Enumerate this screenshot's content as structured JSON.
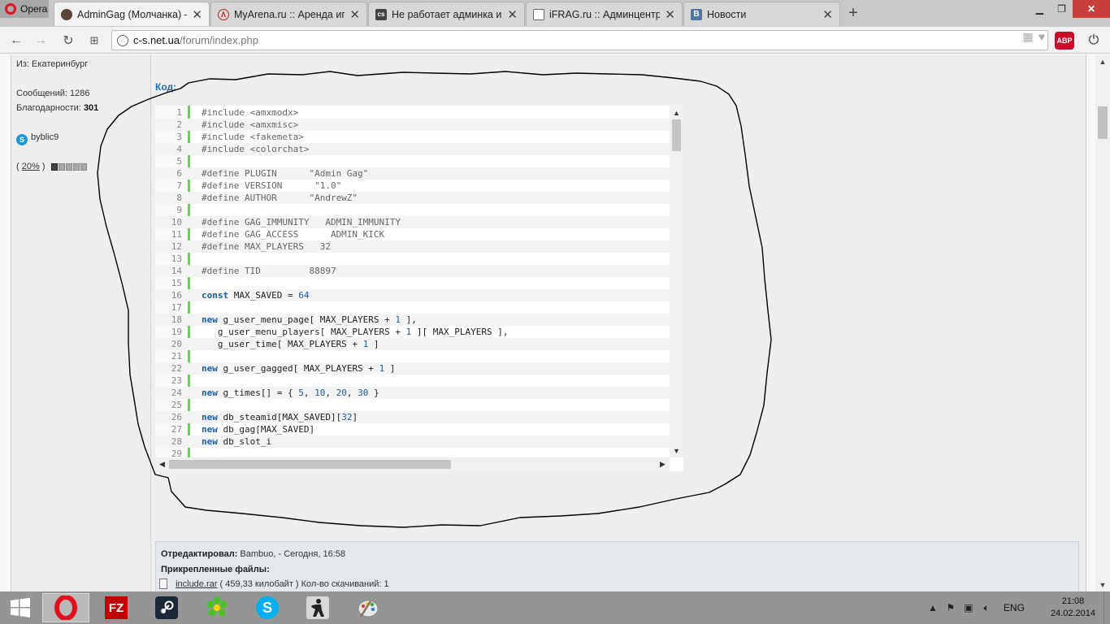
{
  "browser": {
    "menu_label": "Opera",
    "tabs": [
      {
        "title": "AdminGag (Молчанка) —",
        "active": true,
        "favicon": "user-silhouette-icon"
      },
      {
        "title": "MyArena.ru :: Аренда игро",
        "active": false,
        "favicon": "myarena-icon"
      },
      {
        "title": "Не работает админка и п",
        "active": false,
        "favicon": "forum-icon"
      },
      {
        "title": "iFRAG.ru :: Админцентр -",
        "active": false,
        "favicon": "page-icon"
      },
      {
        "title": "Новости",
        "active": false,
        "favicon": "vk-icon"
      }
    ],
    "new_tab": "+",
    "url_host": "c-s.net.ua",
    "url_path": "/forum/index.php",
    "abp_label": "ABP"
  },
  "profile": {
    "location": "Из: Екатеринбург",
    "messages_label": "Сообщений:",
    "messages_value": "1286",
    "thanks_label": "Благодарности:",
    "thanks_value": "301",
    "skype_name": "byblic9",
    "rep_open": "(",
    "rep_percent": "20%",
    "rep_close": ")",
    "rep_level": 0.2
  },
  "post": {
    "code_label": "Код:",
    "code_lines": [
      {
        "n": "1",
        "parts": [
          [
            "p",
            "#include <amxmodx>"
          ]
        ]
      },
      {
        "n": "2",
        "parts": [
          [
            "p",
            "#include <amxmisc>"
          ]
        ]
      },
      {
        "n": "3",
        "parts": [
          [
            "p",
            "#include <fakemeta>"
          ]
        ]
      },
      {
        "n": "4",
        "parts": [
          [
            "p",
            "#include <colorchat>"
          ]
        ]
      },
      {
        "n": "5",
        "parts": []
      },
      {
        "n": "6",
        "parts": [
          [
            "p",
            "#define PLUGIN      \"Admin Gag\""
          ]
        ]
      },
      {
        "n": "7",
        "parts": [
          [
            "p",
            "#define VERSION      \"1.0\""
          ]
        ]
      },
      {
        "n": "8",
        "parts": [
          [
            "p",
            "#define AUTHOR      \"AndrewZ\""
          ]
        ]
      },
      {
        "n": "9",
        "parts": []
      },
      {
        "n": "10",
        "parts": [
          [
            "p",
            "#define GAG_IMMUNITY   ADMIN_IMMUNITY"
          ]
        ]
      },
      {
        "n": "11",
        "parts": [
          [
            "p",
            "#define GAG_ACCESS      ADMIN_KICK"
          ]
        ]
      },
      {
        "n": "12",
        "parts": [
          [
            "p",
            "#define MAX_PLAYERS   32"
          ]
        ]
      },
      {
        "n": "13",
        "parts": []
      },
      {
        "n": "14",
        "parts": [
          [
            "p",
            "#define TID         88897"
          ]
        ]
      },
      {
        "n": "15",
        "parts": []
      },
      {
        "n": "16",
        "parts": [
          [
            "k",
            "const"
          ],
          [
            "t",
            " MAX_SAVED = "
          ],
          [
            "d",
            "64"
          ]
        ]
      },
      {
        "n": "17",
        "parts": []
      },
      {
        "n": "18",
        "parts": [
          [
            "k",
            "new"
          ],
          [
            "t",
            " g_user_menu_page[ MAX_PLAYERS + "
          ],
          [
            "d",
            "1"
          ],
          [
            "t",
            " ],"
          ]
        ]
      },
      {
        "n": "19",
        "parts": [
          [
            "t",
            "   g_user_menu_players[ MAX_PLAYERS + "
          ],
          [
            "d",
            "1"
          ],
          [
            "t",
            " ][ MAX_PLAYERS ],"
          ]
        ]
      },
      {
        "n": "20",
        "parts": [
          [
            "t",
            "   g_user_time[ MAX_PLAYERS + "
          ],
          [
            "d",
            "1"
          ],
          [
            "t",
            " ]"
          ]
        ]
      },
      {
        "n": "21",
        "parts": []
      },
      {
        "n": "22",
        "parts": [
          [
            "k",
            "new"
          ],
          [
            "t",
            " g_user_gagged[ MAX_PLAYERS + "
          ],
          [
            "d",
            "1"
          ],
          [
            "t",
            " ]"
          ]
        ]
      },
      {
        "n": "23",
        "parts": []
      },
      {
        "n": "24",
        "parts": [
          [
            "k",
            "new"
          ],
          [
            "t",
            " g_times[] = { "
          ],
          [
            "d",
            "5"
          ],
          [
            "t",
            ", "
          ],
          [
            "d",
            "10"
          ],
          [
            "t",
            ", "
          ],
          [
            "d",
            "20"
          ],
          [
            "t",
            ", "
          ],
          [
            "d",
            "30"
          ],
          [
            "t",
            " }"
          ]
        ]
      },
      {
        "n": "25",
        "parts": []
      },
      {
        "n": "26",
        "parts": [
          [
            "k",
            "new"
          ],
          [
            "t",
            " db_steamid[MAX_SAVED]["
          ],
          [
            "d",
            "32"
          ],
          [
            "t",
            "]"
          ]
        ]
      },
      {
        "n": "27",
        "parts": [
          [
            "k",
            "new"
          ],
          [
            "t",
            " db_gag[MAX_SAVED]"
          ]
        ]
      },
      {
        "n": "28",
        "parts": [
          [
            "k",
            "new"
          ],
          [
            "t",
            " db_slot_i"
          ]
        ]
      },
      {
        "n": "29",
        "parts": []
      }
    ],
    "edited_label": "Отредактировал:",
    "edited_value": "Bambuo, - Сегодня, 16:58",
    "attachments_label": "Прикрепленные файлы:",
    "attachment_name": "include.rar",
    "attachment_meta": "( 459,33 килобайт ) Кол-во скачиваний: 1"
  },
  "taskbar": {
    "apps": [
      {
        "name": "start-button",
        "icon": "windows-logo-icon"
      },
      {
        "name": "opera-app",
        "icon": "opera-icon",
        "active": true
      },
      {
        "name": "filezilla-app",
        "icon": "filezilla-icon",
        "glyph": "FZ"
      },
      {
        "name": "steam-app",
        "icon": "steam-icon"
      },
      {
        "name": "icq-app",
        "icon": "icq-flower-icon"
      },
      {
        "name": "skype-app",
        "icon": "skype-icon",
        "glyph": "S"
      },
      {
        "name": "counter-strike-app",
        "icon": "counter-strike-icon"
      },
      {
        "name": "paint-app",
        "icon": "paint-palette-icon"
      }
    ],
    "lang": "ENG",
    "time": "21:08",
    "date": "24.02.2014"
  },
  "colors": {
    "accent_blue": "#1f6fb0",
    "code_bar_green": "#6ccf5d",
    "opera_red": "#e0121e",
    "taskbar": "#959595"
  }
}
